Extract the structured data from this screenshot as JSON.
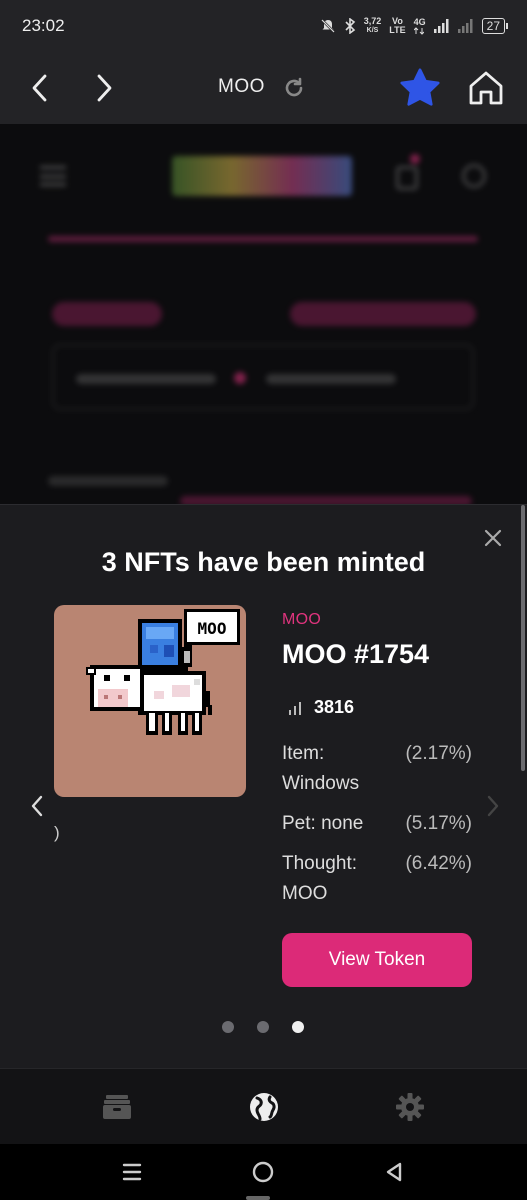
{
  "status_bar": {
    "time": "23:02",
    "net_speed_value": "3,72",
    "net_speed_unit": "K/S",
    "volte_top": "Vo",
    "volte_bottom": "LTE",
    "network_type": "4G",
    "battery": "27"
  },
  "toolbar": {
    "title": "MOO",
    "icons": [
      "back-icon",
      "forward-icon",
      "reload-icon",
      "star-icon",
      "home-icon"
    ],
    "star_color": "#2f55e6"
  },
  "modal": {
    "title": "3 NFTs have been minted",
    "collection": "MOO",
    "token_name": "MOO #1754",
    "rank": "3816",
    "image_bubble_text": "MOO",
    "extra_text": ")",
    "traits": [
      {
        "label": "Item:",
        "value": "Windows",
        "pct": "(2.17%)"
      },
      {
        "label": "Pet: none",
        "value": "",
        "pct": "(5.17%)"
      },
      {
        "label": "Thought:",
        "value": "MOO",
        "pct": "(6.42%)"
      }
    ],
    "view_button": "View Token",
    "pagination": {
      "count": 3,
      "active_index": 2
    },
    "accent": "#dc2a78",
    "card_color": "#b98572"
  },
  "app_nav": {
    "items": [
      "wallet-icon",
      "globe-icon",
      "gear-icon"
    ],
    "active": "globe-icon"
  },
  "system_nav": [
    "recents-icon",
    "home-circle-icon",
    "back-triangle-icon"
  ]
}
